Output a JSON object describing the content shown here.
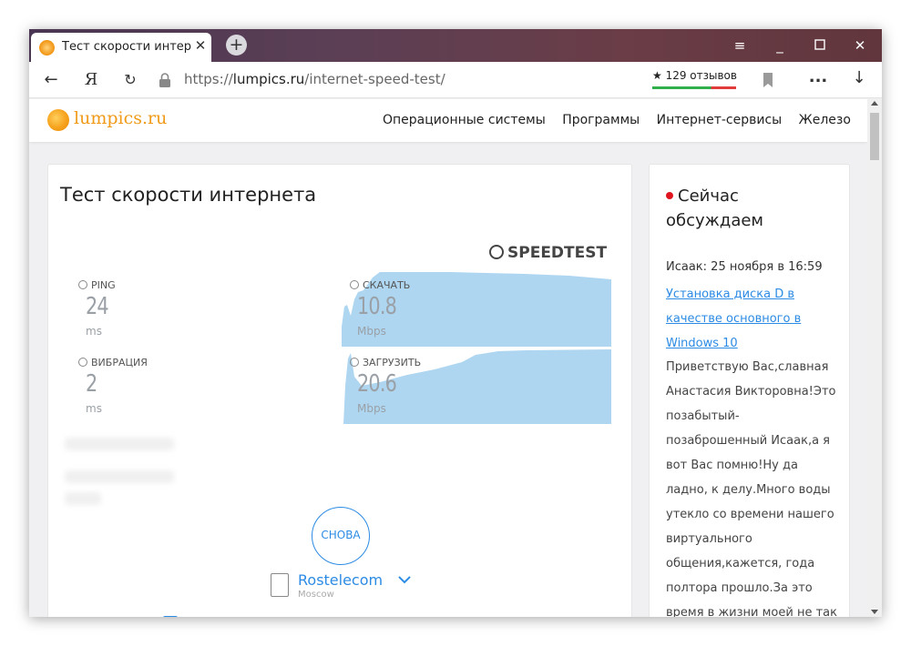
{
  "tab": {
    "title": "Тест скорости интернет",
    "close": "✕",
    "new_tab": "+"
  },
  "window_controls": {
    "menu": "≡",
    "minimize": "_",
    "maximize": "☐",
    "close": "✕"
  },
  "address_bar": {
    "back": "←",
    "yandex": "Я",
    "reload": "↻",
    "url_scheme": "https://",
    "url_host": "lumpics.ru",
    "url_path": "/internet-speed-test/",
    "reviews": "★ 129 отзывов",
    "more": "...",
    "download": "↓"
  },
  "site": {
    "logo": "lumpics.ru",
    "nav": [
      "Операционные системы",
      "Программы",
      "Интернет-сервисы",
      "Железо"
    ]
  },
  "speedtest": {
    "page_title": "Тест скорости интернета",
    "brand": "SPEEDTEST",
    "ping_label": "PING",
    "ping_value": "24",
    "ping_unit": "ms",
    "jitter_label": "ВИБРАЦИЯ",
    "jitter_value": "2",
    "jitter_unit": "ms",
    "download_label": "СКАЧАТЬ",
    "download_value": "10.8",
    "download_unit": "Mbps",
    "upload_label": "ЗАГРУЗИТЬ",
    "upload_value": "20.6",
    "upload_unit": "Mbps",
    "again_button": "СНОВА",
    "server_name": "Rostelecom",
    "server_location": "Moscow",
    "chart_fill": "#aed6f1"
  },
  "sidebar": {
    "heading": "Сейчас обсуждаем",
    "meta": "Исаак: 25 ноября в 16:59",
    "link": "Установка диска D в качестве основного в Windows 10",
    "comment": "Приветствую Вас,славная Анастасия Викторовна!Это позабытый-позаброшенный Исаак,а я вот Вас помню!Ну да ладно, к делу.Много воды утекло со времени нашего виртуального общения,кажется, года полтора прошло.За это время в жизни моей не так"
  },
  "colors": {
    "accent": "#2c8be4",
    "logo": "#f09a18",
    "live_dot": "#e0141f"
  }
}
